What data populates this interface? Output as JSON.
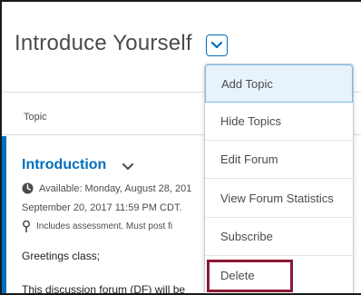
{
  "page": {
    "title": "Introduce Yourself"
  },
  "table": {
    "column_topic": "Topic"
  },
  "topic": {
    "title": "Introduction",
    "available_line1": "Available: Monday, August 28, 201",
    "available_line2": "September 20, 2017 11:59 PM CDT.",
    "assessment_line": "Includes assessment.  Must post fi",
    "greeting": "Greetings class;",
    "description": "This discussion forum (DF) will be"
  },
  "menu": {
    "items": [
      {
        "label": "Add Topic"
      },
      {
        "label": "Hide Topics"
      },
      {
        "label": "Edit Forum"
      },
      {
        "label": "View Forum Statistics"
      },
      {
        "label": "Subscribe"
      },
      {
        "label": "Delete"
      }
    ]
  },
  "colors": {
    "link": "#006fbf",
    "highlight": "#8b1a35",
    "active_item_bg": "#e8f2fa"
  }
}
